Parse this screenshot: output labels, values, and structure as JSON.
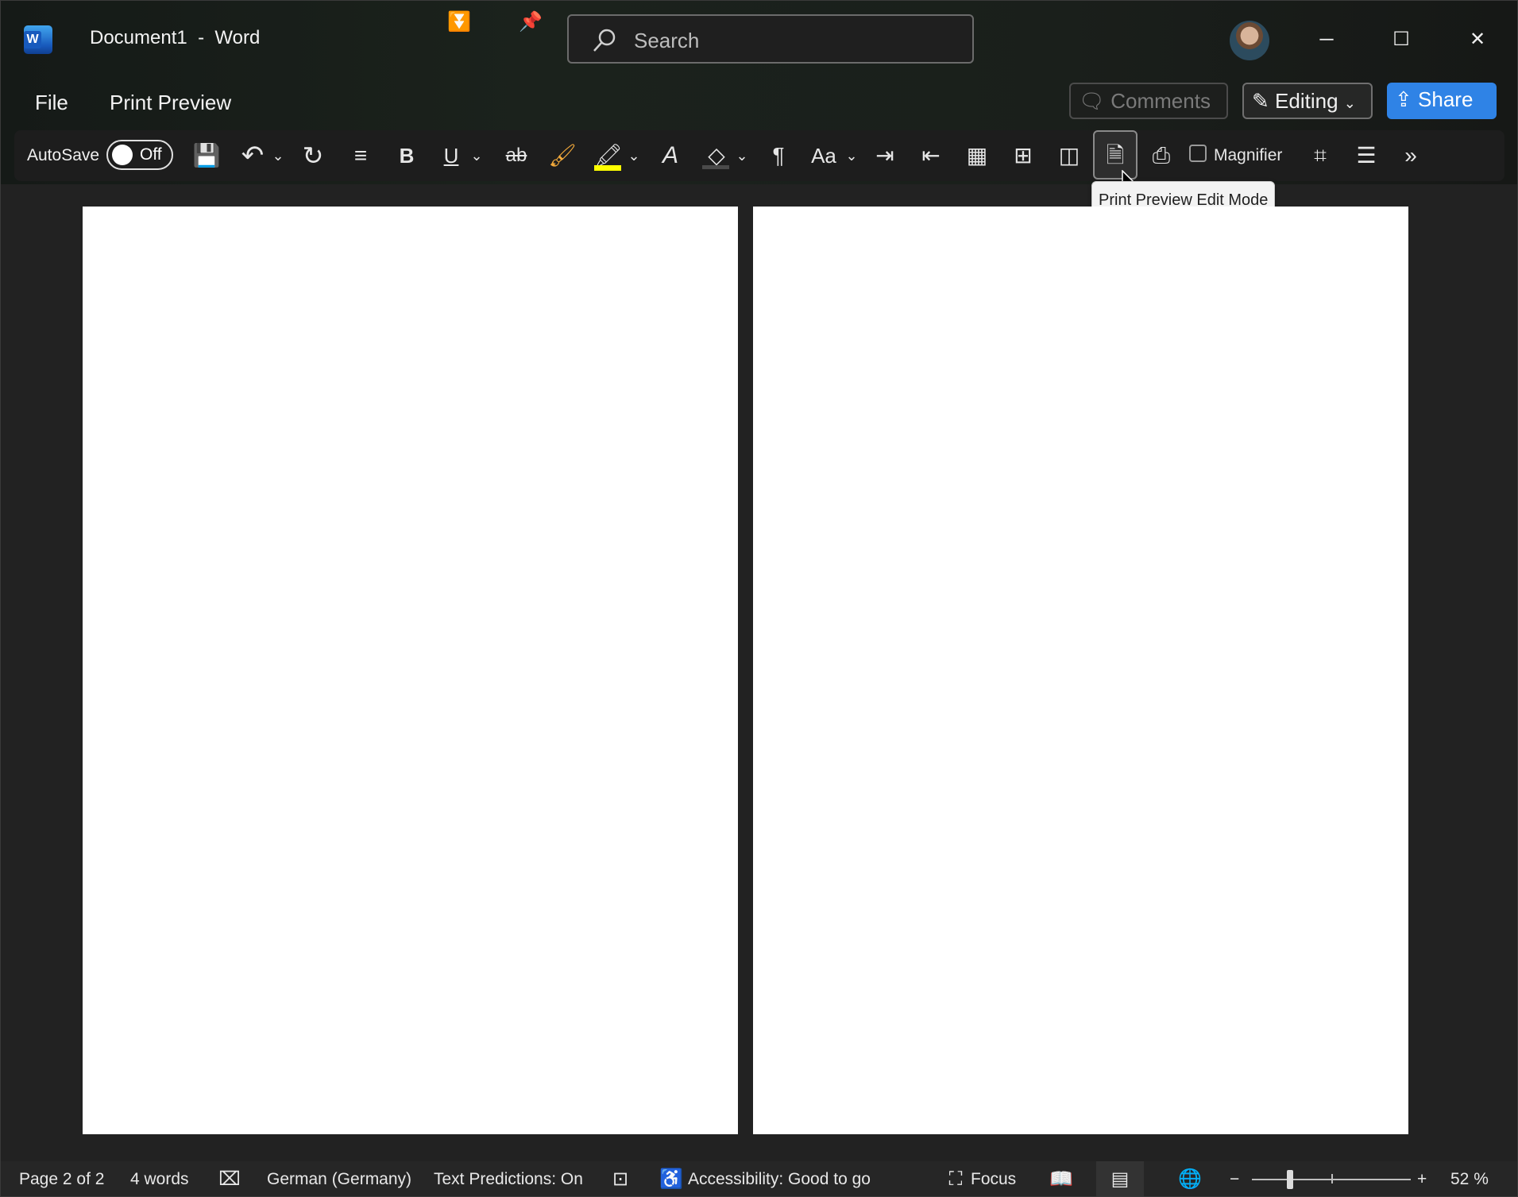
{
  "app": {
    "document_name": "Document1",
    "separator": "-",
    "app_name": "Word"
  },
  "search": {
    "placeholder": "Search"
  },
  "window_controls": {
    "minimize": "─",
    "maximize": "☐",
    "close": "✕"
  },
  "menu": {
    "file": "File",
    "print_preview": "Print Preview"
  },
  "actions": {
    "comments": "Comments",
    "editing": "Editing",
    "share": "Share"
  },
  "ribbon": {
    "autosave_label": "AutoSave",
    "autosave_state": "Off",
    "magnifier_label": "Magnifier",
    "icons": [
      "save-icon",
      "undo-icon",
      "redo-icon",
      "line-spacing-icon",
      "bold-icon",
      "underline-icon",
      "strikethrough-icon",
      "format-painter-icon",
      "highlight-icon",
      "clear-formatting-icon",
      "shading-icon",
      "paragraph-marks-icon",
      "change-case-icon",
      "increase-indent-icon",
      "decrease-indent-icon",
      "table-icon",
      "insert-table-icon",
      "columns-icon",
      "print-preview-edit-mode-icon",
      "print-icon",
      "crop-icon",
      "paragraph-settings-icon",
      "more-icon"
    ],
    "glyphs": {
      "save": "💾",
      "undo": "↶",
      "redo": "↻",
      "line_spacing": "≡",
      "bold": "B",
      "underline": "U",
      "strike": "ab",
      "painter": "🖌",
      "highlight": "🖍",
      "clear": "A",
      "shading": "◇",
      "para": "¶",
      "case": "Aa",
      "indent_in": "⇥",
      "indent_out": "⇤",
      "table": "▦",
      "insert_table": "⊞",
      "columns": "◫",
      "preview": "🗎",
      "print": "⎙",
      "crop": "⌗",
      "para_settings": "☰",
      "more": "»",
      "dropdown": "⌄"
    }
  },
  "tooltip": {
    "text": "Print Preview Edit Mode"
  },
  "status": {
    "page": "Page 2 of 2",
    "words": "4 words",
    "language": "German (Germany)",
    "predictions": "Text Predictions: On",
    "accessibility": "Accessibility: Good to go",
    "focus": "Focus",
    "zoom_minus": "−",
    "zoom_plus": "+",
    "zoom_level": "52 %"
  },
  "colors": {
    "share_blue": "#2f83e6",
    "highlight_yellow": "#ffff00",
    "save_purple": "#c64fbd",
    "painter_orange": "#f2a93b"
  }
}
